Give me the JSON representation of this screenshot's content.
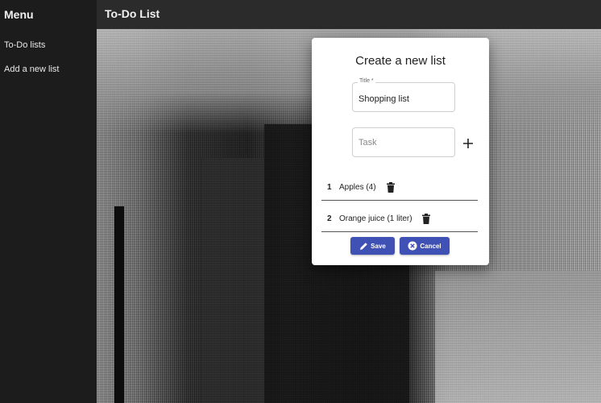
{
  "sidebar": {
    "header": "Menu",
    "items": [
      {
        "label": "To-Do lists"
      },
      {
        "label": "Add a new list"
      }
    ]
  },
  "appbar": {
    "title": "To-Do List"
  },
  "dialog": {
    "title": "Create a new list",
    "title_field": {
      "label": "Title *",
      "value": "Shopping list"
    },
    "task_field": {
      "placeholder": "Task",
      "value": ""
    },
    "add_icon": "plus-icon",
    "tasks": [
      {
        "number": "1",
        "text": "Apples (4)",
        "icon": "trash-icon"
      },
      {
        "number": "2",
        "text": "Orange juice (1 liter)",
        "icon": "trash-icon"
      }
    ],
    "save_label": "Save",
    "cancel_label": "Cancel",
    "save_icon": "pencil-icon",
    "cancel_icon": "cancel-circle-icon"
  },
  "colors": {
    "primary": "#3f51b5",
    "sidebar_bg": "#1c1c1c",
    "appbar_bg": "#2b2b2b"
  }
}
